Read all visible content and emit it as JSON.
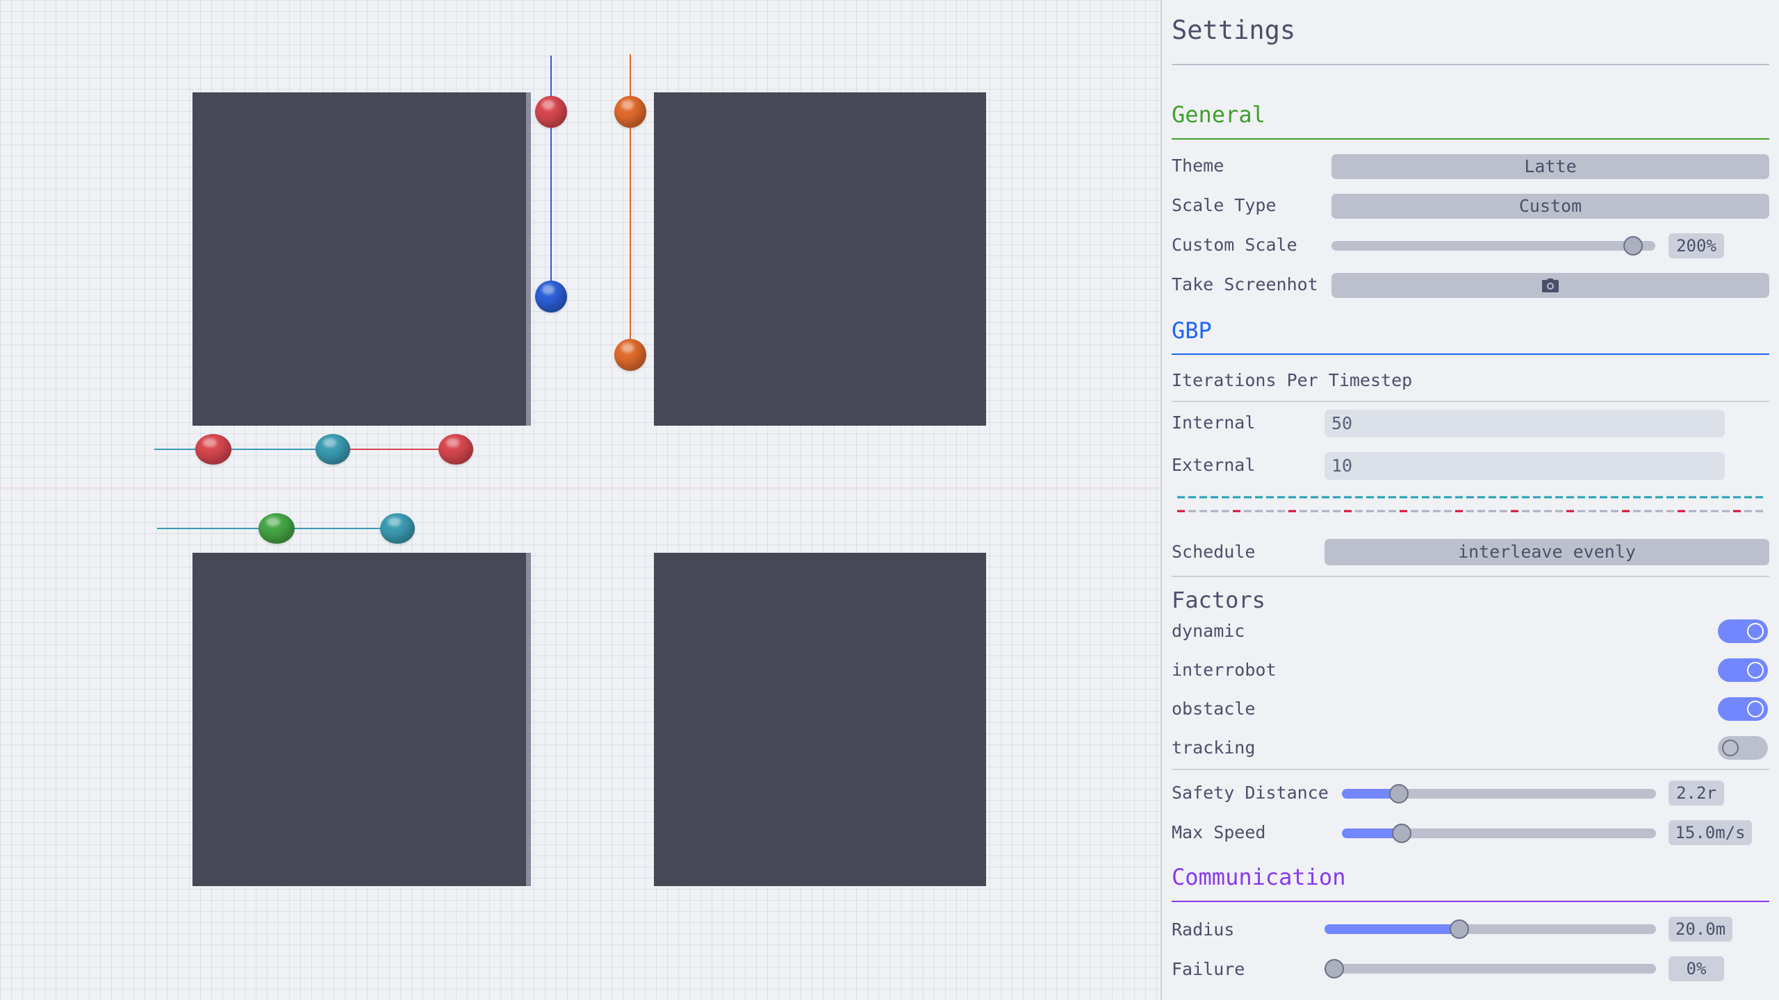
{
  "colors": {
    "general": "#40a02b",
    "gbp": "#1e66f5",
    "communication": "#8839ef",
    "obstacle": "#474855",
    "robot_red": "#d7474f",
    "robot_orange": "#e06a2c",
    "robot_blue": "#2c5fd7",
    "robot_teal": "#3b9bb2",
    "robot_green": "#45a545",
    "toggle_on": "#7287fd"
  },
  "viewport": {
    "robots": [
      {
        "name": "robot-red",
        "color": "#d7474f"
      },
      {
        "name": "robot-orange",
        "color": "#e06a2c"
      },
      {
        "name": "robot-blue",
        "color": "#2c5fd7"
      },
      {
        "name": "robot-teal",
        "color": "#3b9bb2"
      },
      {
        "name": "robot-green",
        "color": "#45a545"
      }
    ]
  },
  "settings": {
    "title": "Settings",
    "general": {
      "heading": "General",
      "theme_label": "Theme",
      "theme_value": "Latte",
      "scale_type_label": "Scale Type",
      "scale_type_value": "Custom",
      "custom_scale_label": "Custom Scale",
      "custom_scale_value": "200%",
      "custom_scale_fraction": 0.96,
      "screenshot_label": "Take Screenhot",
      "screenshot_icon": "camera-icon"
    },
    "gbp": {
      "heading": "GBP",
      "iterations_label": "Iterations Per Timestep",
      "internal_label": "Internal",
      "internal_value": "50",
      "external_label": "External",
      "external_value": "10",
      "schedule_label": "Schedule",
      "schedule_value": "interleave evenly"
    },
    "factors": {
      "heading": "Factors",
      "items": [
        {
          "label": "dynamic",
          "enabled": true
        },
        {
          "label": "interrobot",
          "enabled": true
        },
        {
          "label": "obstacle",
          "enabled": true
        },
        {
          "label": "tracking",
          "enabled": false
        }
      ],
      "safety_label": "Safety Distance",
      "safety_value": "2.2r",
      "safety_fraction": 0.16,
      "speed_label": "Max Speed",
      "speed_value": "15.0m/s",
      "speed_fraction": 0.17
    },
    "communication": {
      "heading": "Communication",
      "radius_label": "Radius",
      "radius_value": "20.0m",
      "radius_fraction": 0.4,
      "failure_label": "Failure",
      "failure_value": "0%",
      "failure_fraction": 0.0
    }
  }
}
